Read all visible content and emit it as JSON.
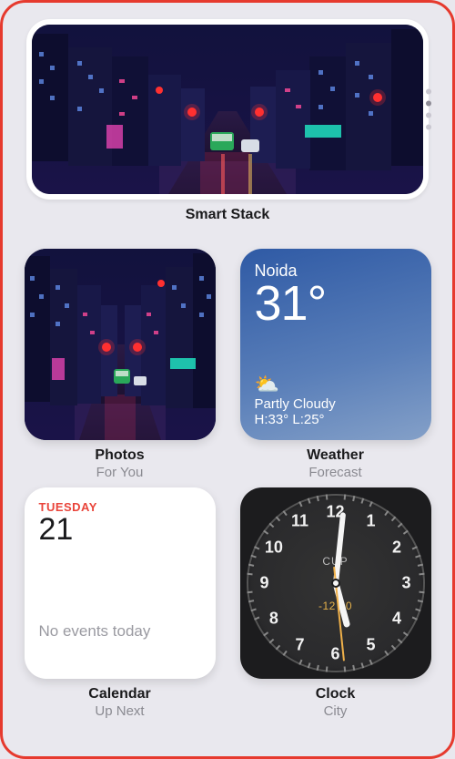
{
  "smartStack": {
    "label": "Smart Stack"
  },
  "photos": {
    "title": "Photos",
    "subtitle": "For You"
  },
  "weather": {
    "title": "Weather",
    "subtitle": "Forecast",
    "location": "Noida",
    "temperature": "31°",
    "condition": "Partly Cloudy",
    "high_low": "H:33° L:25°",
    "icon_glyph": "⛅"
  },
  "calendar": {
    "title": "Calendar",
    "subtitle": "Up Next",
    "weekday": "TUESDAY",
    "day": "21",
    "events_text": "No events today"
  },
  "clock": {
    "title": "Clock",
    "subtitle": "City",
    "brand": "CUP",
    "subdial": "-12 30"
  }
}
